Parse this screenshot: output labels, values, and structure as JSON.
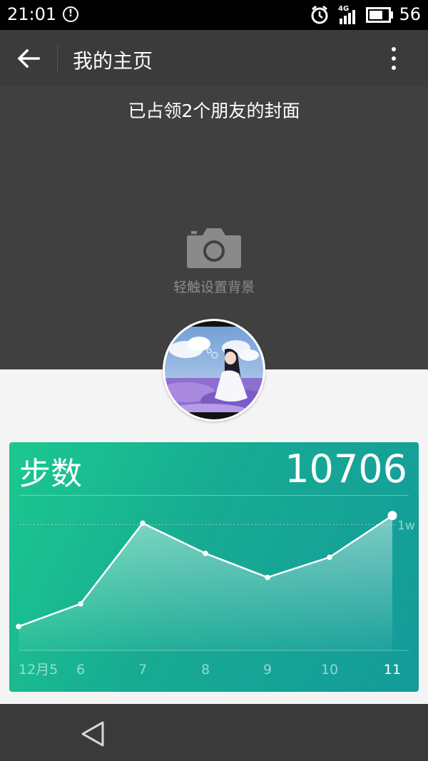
{
  "status_bar": {
    "time": "21:01",
    "network": "4G",
    "battery": "56"
  },
  "app_bar": {
    "title": "我的主页"
  },
  "cover": {
    "headline": "已占领2个朋友的封面",
    "set_background_label": "轻触设置背景"
  },
  "steps_card": {
    "title": "步数",
    "value": "10706"
  },
  "colors": {
    "card_gradient_start": "#1cc88f",
    "card_gradient_end": "#139a9a",
    "cover_bg": "#404041",
    "app_bar_bg": "#3b3b3b"
  },
  "chart_data": {
    "type": "area",
    "categories": [
      "12月5",
      "6",
      "7",
      "8",
      "9",
      "10",
      "11"
    ],
    "values": [
      1900,
      3700,
      10100,
      7700,
      5800,
      7400,
      10706
    ],
    "ylim": [
      0,
      12000
    ],
    "reference_line": {
      "value": 10000,
      "label": "1w"
    },
    "highlight_index": 6
  }
}
